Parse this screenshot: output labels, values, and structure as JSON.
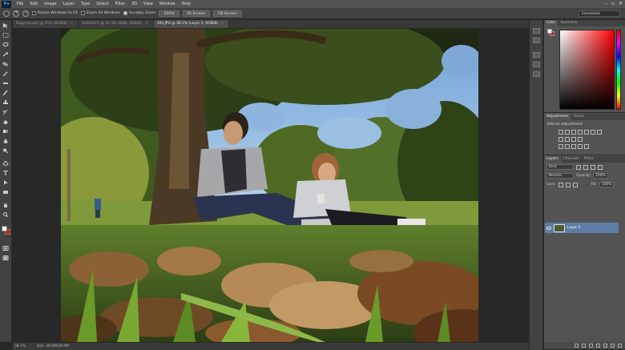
{
  "app": {
    "logo": "Ps",
    "menu": [
      "File",
      "Edit",
      "Image",
      "Layer",
      "Type",
      "Select",
      "Filter",
      "3D",
      "View",
      "Window",
      "Help"
    ],
    "window_controls": [
      "–",
      "▫",
      "✕"
    ]
  },
  "options_bar": {
    "resize_windows_label": "Resize Windows to Fit",
    "resize_windows_checked": false,
    "zoom_all_label": "Zoom All Windows",
    "zoom_all_checked": false,
    "scrubby_label": "Scrubby Zoom",
    "scrubby_checked": true,
    "btn_100": "100%",
    "btn_fit": "Fit Screen",
    "btn_fill": "Fill Screen",
    "workspace": "Essentials"
  },
  "tabs": [
    {
      "label": "Diagram.psd @ 25% (RGB/8)",
      "active": false
    },
    {
      "label": "Untitled-1 @ 33.3% (Walk, RGB/8)",
      "active": false
    },
    {
      "label": "392.JPG @ 38.1% (Layer 0, RGB/8)",
      "active": true
    }
  ],
  "status": {
    "zoom": "38.1%",
    "doc": "Doc: 36.0M/29.0M"
  },
  "panels": {
    "color_tabs": [
      "Color",
      "Swatches"
    ],
    "adjust_tabs": [
      "Adjustments",
      "Styles"
    ],
    "adjust_title": "Add an adjustment",
    "layers_tabs": [
      "Layers",
      "Channels",
      "Paths"
    ],
    "kind_label": "Kind",
    "blend_mode": "Normal",
    "opacity_label": "Opacity:",
    "opacity_value": "100%",
    "lock_label": "Lock:",
    "fill_label": "Fill:",
    "fill_value": "100%",
    "layer_name": "Layer 0"
  },
  "colors": {
    "foreground": "#ffffff",
    "background": "#d7121b",
    "layer_highlight": "#5d7da5"
  },
  "icons": {
    "tools": [
      "move-icon",
      "marquee-icon",
      "lasso-icon",
      "quick-select-icon",
      "crop-icon",
      "eyedropper-icon",
      "spot-heal-icon",
      "brush-icon",
      "clone-stamp-icon",
      "history-brush-icon",
      "eraser-icon",
      "gradient-icon",
      "blur-icon",
      "dodge-icon",
      "pen-icon",
      "type-icon",
      "path-select-icon",
      "shape-icon",
      "hand-icon",
      "zoom-icon"
    ]
  }
}
